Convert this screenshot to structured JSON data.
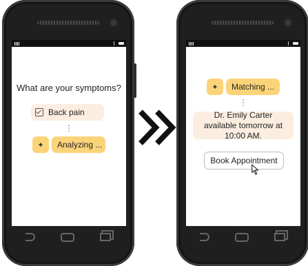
{
  "left_screen": {
    "question": "What are your symptoms?",
    "symptom_label": "Back pain",
    "status_label": "Analyzing ...",
    "icons": {
      "symptom": "checkbox-icon",
      "status": "sparkle-icon"
    }
  },
  "right_screen": {
    "status_label": "Matching ...",
    "result_text": "Dr. Emily Carter available tomorrow at 10:00 AM.",
    "book_label": "Book Appointment",
    "icons": {
      "status": "sparkle-icon",
      "cursor": "pointer-cursor-icon"
    }
  },
  "transition_icon": "double-chevron-right-icon",
  "colors": {
    "accent": "#fbd47a",
    "soft": "#fbeee0",
    "phone": "#1f1f1f"
  }
}
